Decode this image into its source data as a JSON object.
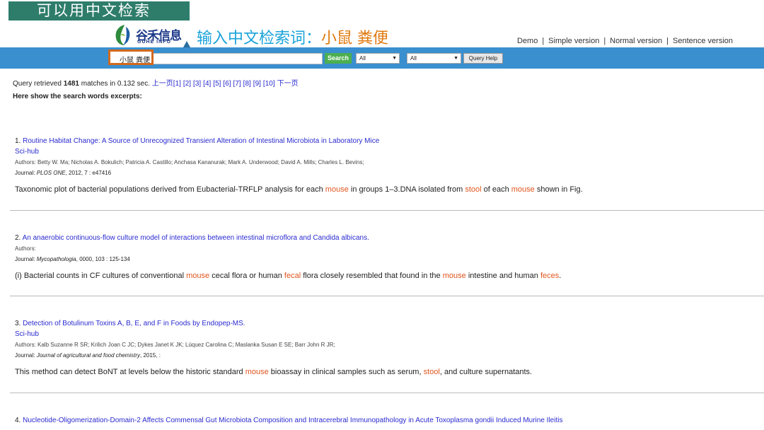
{
  "overlay": {
    "tag_label": "可以用中文检索",
    "headline_prefix": "输入中文检索词：",
    "headline_keywords": "小鼠 粪便"
  },
  "logo": {
    "cn": "谷禾信息",
    "en": "GUHE INFO"
  },
  "nav_links": [
    "Demo",
    "Simple version",
    "Normal version",
    "Sentence version"
  ],
  "search": {
    "query": "小鼠 粪便",
    "button": "Search",
    "select1": "All",
    "select2": "All",
    "help": "Query Help"
  },
  "stats": {
    "prefix": "Query retrieved",
    "count": "1481",
    "suffix": "matches in 0.132 sec.",
    "prev": "上一页",
    "pages": [
      "[1]",
      "[2]",
      "[3]",
      "[4]",
      "[5]",
      "[6]",
      "[7]",
      "[8]",
      "[9]",
      "[10]"
    ],
    "next": "下一页"
  },
  "excerpt_heading": "Here show the search words excerpts:",
  "results": [
    {
      "num": "1.",
      "title": "Routine Habitat Change: A Source of Unrecognized Transient Alteration of Intestinal Microbiota in Laboratory Mice",
      "scihub": "Sci-hub",
      "authors": "Authors: Betty W. Ma; Nicholas A. Bokulich; Patricia A. Castillo; Anchasa Kananurak; Mark A. Underwood; David A. Mills; Charles L. Bevins;",
      "journal_label": "Journal:",
      "journal": "PLOS ONE",
      "journal_info": ", 2012, 7 : e47416",
      "snippet": [
        {
          "t": "Taxonomic plot of bacterial populations derived from Eubacterial-TRFLP analysis for each ",
          "k": false
        },
        {
          "t": "mouse",
          "k": true
        },
        {
          "t": " in groups 1–3.DNA isolated from ",
          "k": false
        },
        {
          "t": "stool",
          "k": true
        },
        {
          "t": " of each ",
          "k": false
        },
        {
          "t": "mouse",
          "k": true
        },
        {
          "t": " shown in Fig.",
          "k": false
        }
      ]
    },
    {
      "num": "2.",
      "title": "An anaerobic continuous-flow culture model of interactions between intestinal microflora and Candida albicans.",
      "scihub": "",
      "authors": "Authors:",
      "journal_label": "Journal:",
      "journal": "Mycopathologia",
      "journal_info": ", 0000, 103 : 125-134",
      "snippet": [
        {
          "t": "(i) Bacterial counts in CF cultures of conventional ",
          "k": false
        },
        {
          "t": "mouse",
          "k": true
        },
        {
          "t": " cecal flora or human ",
          "k": false
        },
        {
          "t": "fecal",
          "k": true
        },
        {
          "t": " flora closely resembled that found in the ",
          "k": false
        },
        {
          "t": "mouse",
          "k": true
        },
        {
          "t": " intestine and human ",
          "k": false
        },
        {
          "t": "feces",
          "k": true
        },
        {
          "t": ".",
          "k": false
        }
      ]
    },
    {
      "num": "3.",
      "title": "Detection of Botulinum Toxins A, B, E, and F in Foods by Endopep-MS.",
      "scihub": "Sci-hub",
      "authors": "Authors: Kalb Suzanne R SR; Krilich Joan C JC; Dykes Janet K JK; Lúquez Carolina C; Maslanka Susan E SE; Barr John R JR;",
      "journal_label": "Journal:",
      "journal": "Journal of agricultural and food chemistry",
      "journal_info": ", 2015, :",
      "snippet": [
        {
          "t": "This method can detect BoNT at levels below the historic standard ",
          "k": false
        },
        {
          "t": "mouse",
          "k": true
        },
        {
          "t": " bioassay in clinical samples such as serum, ",
          "k": false
        },
        {
          "t": "stool",
          "k": true
        },
        {
          "t": ", and culture supernatants.",
          "k": false
        }
      ]
    },
    {
      "num": "4.",
      "title": "Nucleotide-Oligomerization-Domain-2 Affects Commensal Gut Microbiota Composition and Intracerebral Immunopathology in Acute Toxoplasma gondii Induced Murine Ileitis",
      "scihub": "",
      "authors": "",
      "journal_label": "",
      "journal": "",
      "journal_info": "",
      "snippet": []
    }
  ]
}
